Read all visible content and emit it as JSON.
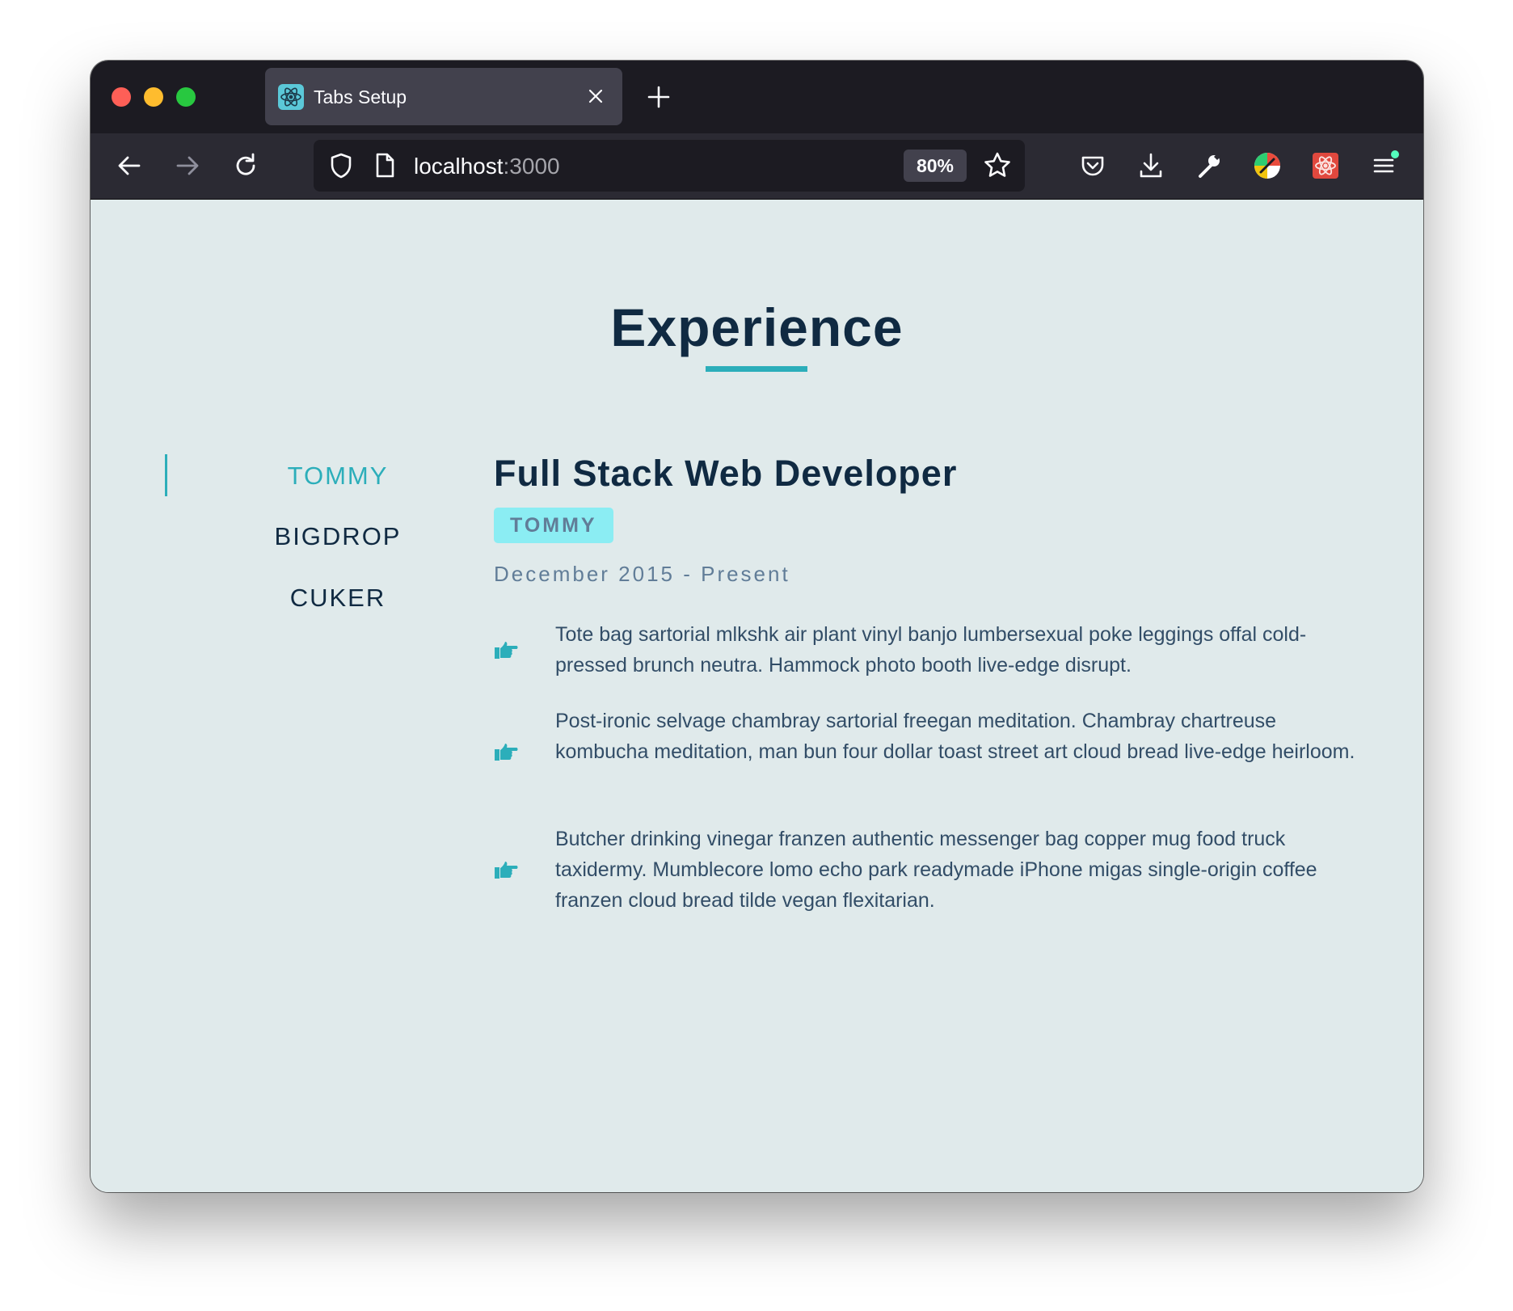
{
  "browser": {
    "tab_title": "Tabs Setup",
    "url_host": "localhost",
    "url_port": ":3000",
    "zoom": "80%"
  },
  "colors": {
    "accent": "#2caeba",
    "badge_bg": "#8bedf3",
    "heading": "#102a42",
    "page_bg": "#e0eaeb"
  },
  "page": {
    "title": "Experience",
    "companies": [
      {
        "label": "TOMMY",
        "active": true
      },
      {
        "label": "BIGDROP",
        "active": false
      },
      {
        "label": "CUKER",
        "active": false
      }
    ],
    "job": {
      "title": "Full Stack Web Developer",
      "company": "TOMMY",
      "dates": "December 2015 - Present",
      "duties": [
        "Tote bag sartorial mlkshk air plant vinyl banjo lumbersexual poke leggings offal cold-pressed brunch neutra. Hammock photo booth live-edge disrupt.",
        "Post-ironic selvage chambray sartorial freegan meditation. Chambray chartreuse kombucha meditation, man bun four dollar toast street art cloud bread live-edge heirloom.",
        "Butcher drinking vinegar franzen authentic messenger bag copper mug food truck taxidermy. Mumblecore lomo echo park readymade iPhone migas single-origin coffee franzen cloud bread tilde vegan flexitarian."
      ],
      "duty_icon": "hand-pointing-right-icon"
    }
  }
}
